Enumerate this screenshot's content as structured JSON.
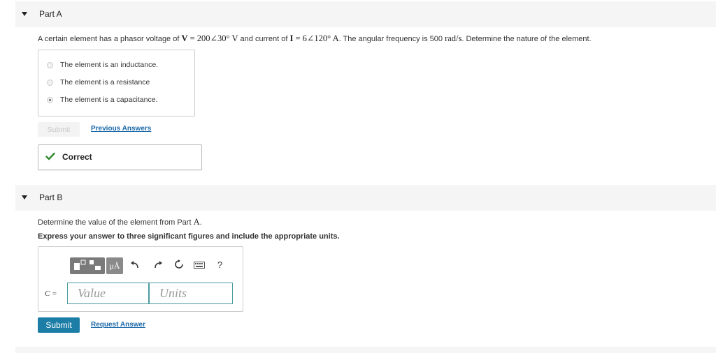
{
  "part_a": {
    "title": "Part A",
    "question_pre": "A certain element has a phasor voltage of",
    "v_symbol": "V",
    "v_value": "= 200∠30°",
    "v_unit": "V",
    "mid": "and current of",
    "i_symbol": "I",
    "i_value": "= 6∠120°",
    "i_unit": "A",
    "post1": ". The angular frequency is 500",
    "freq_unit": "rad/s",
    "post2": ". Determine the nature of the element.",
    "choices": [
      {
        "label": "The element is an inductance.",
        "selected": false
      },
      {
        "label": "The element is a resistance",
        "selected": false
      },
      {
        "label": "The element is a capacitance.",
        "selected": true
      }
    ],
    "submit_label": "Submit",
    "previous_answers_label": "Previous Answers",
    "feedback_label": "Correct"
  },
  "part_b": {
    "title": "Part B",
    "question_pre": "Determine the value of the element from Part",
    "question_ref": "A",
    "question_post": ".",
    "instruction": "Express your answer to three significant figures and include the appropriate units.",
    "toolbar": {
      "units_label": "μÅ",
      "help_label": "?"
    },
    "variable_label": "C =",
    "value_placeholder": "Value",
    "units_placeholder": "Units",
    "submit_label": "Submit",
    "request_answer_label": "Request Answer"
  },
  "colors": {
    "accent": "#1c7da6",
    "link": "#1a68a8",
    "correct_check": "#2e8b2e",
    "input_border": "#4a9b9f"
  }
}
